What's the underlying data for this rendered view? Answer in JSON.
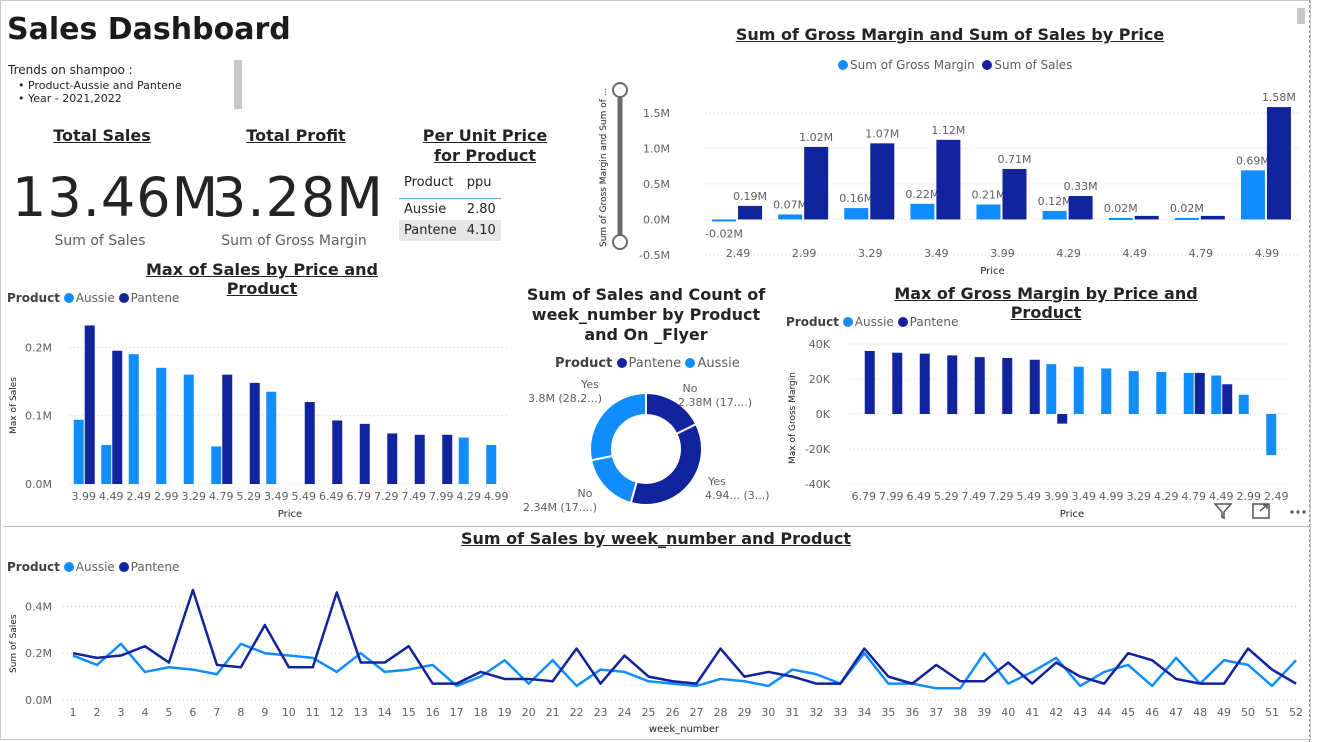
{
  "title": "Sales Dashboard",
  "trends": {
    "heading": "Trends on shampoo :",
    "items": [
      "Product-Aussie and Pantene",
      "Year - 2021,2022"
    ]
  },
  "kpis": {
    "total_sales": {
      "label": "Total Sales",
      "value": "13.46M",
      "sub": "Sum of Sales"
    },
    "total_profit": {
      "label": "Total Profit",
      "value": "3.28M",
      "sub": "Sum of Gross Margin"
    }
  },
  "ppu": {
    "title": "Per Unit Price for Product",
    "headers": [
      "Product",
      "ppu"
    ],
    "rows": [
      [
        "Aussie",
        "2.80"
      ],
      [
        "Pantene",
        "4.10"
      ]
    ]
  },
  "colors": {
    "aussie": "#118dff",
    "pantene": "#12239e"
  },
  "icons": [
    "filter-icon",
    "focus-mode-icon",
    "more-options-icon"
  ],
  "chart_data": [
    {
      "id": "gm_sales_by_price",
      "type": "bar",
      "title": "Sum of Gross Margin and Sum of Sales by Price",
      "xlabel": "Price",
      "ylabel": "Sum of Gross Margin and Sum of ...",
      "ylim": [
        -0.5,
        1.75
      ],
      "yticks": [
        "1.5M",
        "1.0M",
        "0.5M",
        "0.0M",
        "-0.5M"
      ],
      "categories": [
        "2.49",
        "2.99",
        "3.29",
        "3.49",
        "3.99",
        "4.29",
        "4.49",
        "4.79",
        "4.99"
      ],
      "series": [
        {
          "name": "Sum of Gross Margin",
          "color": "#118dff",
          "values": [
            -0.02,
            0.07,
            0.16,
            0.22,
            0.21,
            0.12,
            0.02,
            0.02,
            0.69
          ],
          "labels": [
            "-0.02M",
            "0.07M",
            "0.16M",
            "0.22M",
            "0.21M",
            "0.12M",
            "0.02M",
            "0.02M",
            "0.69M"
          ]
        },
        {
          "name": "Sum of Sales",
          "color": "#12239e",
          "values": [
            0.19,
            1.02,
            1.07,
            1.12,
            0.71,
            0.33,
            0.05,
            0.05,
            1.58
          ],
          "labels": [
            "0.19M",
            "1.02M",
            "1.07M",
            "1.12M",
            "0.71M",
            "0.33M",
            "",
            "",
            "1.58M"
          ]
        }
      ],
      "legend": "top-center"
    },
    {
      "id": "max_sales_by_price",
      "type": "bar",
      "title": "Max of Sales by Price and Product",
      "xlabel": "Price",
      "ylabel": "Max of Sales",
      "legend_title": "Product",
      "ylim": [
        0,
        0.24
      ],
      "yticks": [
        "0.2M",
        "0.1M",
        "0.0M"
      ],
      "categories": [
        "3.99",
        "4.49",
        "2.49",
        "2.99",
        "3.29",
        "4.79",
        "5.29",
        "3.49",
        "5.49",
        "6.49",
        "6.79",
        "7.29",
        "7.49",
        "7.99",
        "4.29",
        "4.99"
      ],
      "series": [
        {
          "name": "Aussie",
          "color": "#118dff",
          "values": [
            0.094,
            0.057,
            0.19,
            0.17,
            0.16,
            0.055,
            null,
            0.135,
            null,
            null,
            null,
            null,
            null,
            null,
            0.068,
            0.057
          ]
        },
        {
          "name": "Pantene",
          "color": "#12239e",
          "values": [
            0.232,
            0.195,
            null,
            null,
            null,
            0.16,
            0.148,
            null,
            0.12,
            0.093,
            0.088,
            0.074,
            0.072,
            0.072,
            null,
            null
          ]
        }
      ]
    },
    {
      "id": "sales_by_product_flyer",
      "type": "pie",
      "title": "Sum of Sales and Count of week_number by Product and On _Flyer",
      "legend_title": "Product",
      "legend": [
        {
          "name": "Pantene",
          "color": "#12239e"
        },
        {
          "name": "Aussie",
          "color": "#118dff"
        }
      ],
      "slices": [
        {
          "label": "No",
          "value": 2.38,
          "text": "2.38M (17....)",
          "color": "#12239e"
        },
        {
          "label": "Yes",
          "value": 4.94,
          "text": "4.94... (3...)",
          "color": "#12239e"
        },
        {
          "label": "No",
          "value": 2.34,
          "text": "2.34M (17....)",
          "color": "#118dff"
        },
        {
          "label": "Yes",
          "value": 3.8,
          "text": "3.8M (28.2...)",
          "color": "#118dff"
        }
      ]
    },
    {
      "id": "max_gm_by_price",
      "type": "bar",
      "title": "Max of Gross Margin by Price and Product",
      "xlabel": "Price",
      "ylabel": "Max of Gross Margin",
      "legend_title": "Product",
      "ylim": [
        -40,
        40
      ],
      "yticks": [
        "40K",
        "20K",
        "0K",
        "-20K",
        "-40K"
      ],
      "categories": [
        "6.79",
        "7.99",
        "6.49",
        "5.29",
        "7.49",
        "7.29",
        "5.49",
        "3.99",
        "3.49",
        "4.99",
        "3.29",
        "4.29",
        "4.79",
        "4.49",
        "2.99",
        "2.49"
      ],
      "xtick_labels": [
        "6.79",
        "7.99",
        "6.49",
        "5.29",
        "7.49",
        "7.29",
        "5.49",
        "3.99",
        "3.49",
        "4.99",
        "3.29",
        "4.29",
        "4.79",
        "4.49",
        "2.99",
        "2.49"
      ],
      "series": [
        {
          "name": "Aussie",
          "color": "#118dff",
          "values": [
            null,
            null,
            null,
            null,
            null,
            null,
            null,
            28.5,
            27,
            26,
            24.5,
            24,
            23.5,
            22,
            11,
            -23.5
          ]
        },
        {
          "name": "Pantene",
          "color": "#12239e",
          "values": [
            36,
            35,
            34.5,
            33.5,
            32.5,
            32,
            31,
            -5.5,
            null,
            null,
            null,
            null,
            23.5,
            17,
            null,
            null
          ]
        }
      ]
    },
    {
      "id": "sales_by_week",
      "type": "line",
      "title": "Sum of Sales by week_number and Product",
      "xlabel": "week_number",
      "ylabel": "Sum of Sales",
      "legend_title": "Product",
      "ylim": [
        0,
        0.5
      ],
      "yticks": [
        "0.4M",
        "0.2M",
        "0.0M"
      ],
      "x": [
        1,
        2,
        3,
        4,
        5,
        6,
        7,
        8,
        9,
        10,
        11,
        12,
        13,
        14,
        15,
        16,
        17,
        18,
        19,
        20,
        21,
        22,
        23,
        24,
        25,
        26,
        27,
        28,
        29,
        30,
        31,
        32,
        33,
        34,
        35,
        36,
        37,
        38,
        39,
        40,
        41,
        42,
        43,
        44,
        45,
        46,
        47,
        48,
        49,
        50,
        51,
        52
      ],
      "series": [
        {
          "name": "Aussie",
          "color": "#118dff",
          "values": [
            0.19,
            0.15,
            0.24,
            0.12,
            0.14,
            0.13,
            0.11,
            0.24,
            0.2,
            0.19,
            0.18,
            0.12,
            0.2,
            0.12,
            0.13,
            0.15,
            0.06,
            0.1,
            0.17,
            0.07,
            0.17,
            0.06,
            0.13,
            0.12,
            0.08,
            0.07,
            0.06,
            0.09,
            0.08,
            0.06,
            0.13,
            0.11,
            0.07,
            0.2,
            0.07,
            0.07,
            0.05,
            0.05,
            0.2,
            0.07,
            0.12,
            0.18,
            0.06,
            0.12,
            0.15,
            0.06,
            0.18,
            0.07,
            0.17,
            0.15,
            0.06,
            0.17
          ]
        },
        {
          "name": "Pantene",
          "color": "#12239e",
          "values": [
            0.2,
            0.18,
            0.19,
            0.23,
            0.16,
            0.47,
            0.15,
            0.14,
            0.32,
            0.14,
            0.14,
            0.46,
            0.16,
            0.16,
            0.23,
            0.07,
            0.07,
            0.12,
            0.09,
            0.09,
            0.08,
            0.22,
            0.07,
            0.19,
            0.1,
            0.08,
            0.07,
            0.22,
            0.1,
            0.12,
            0.1,
            0.07,
            0.07,
            0.22,
            0.1,
            0.07,
            0.15,
            0.08,
            0.08,
            0.16,
            0.07,
            0.16,
            0.1,
            0.07,
            0.2,
            0.17,
            0.09,
            0.07,
            0.07,
            0.22,
            0.13,
            0.07
          ]
        }
      ]
    }
  ]
}
